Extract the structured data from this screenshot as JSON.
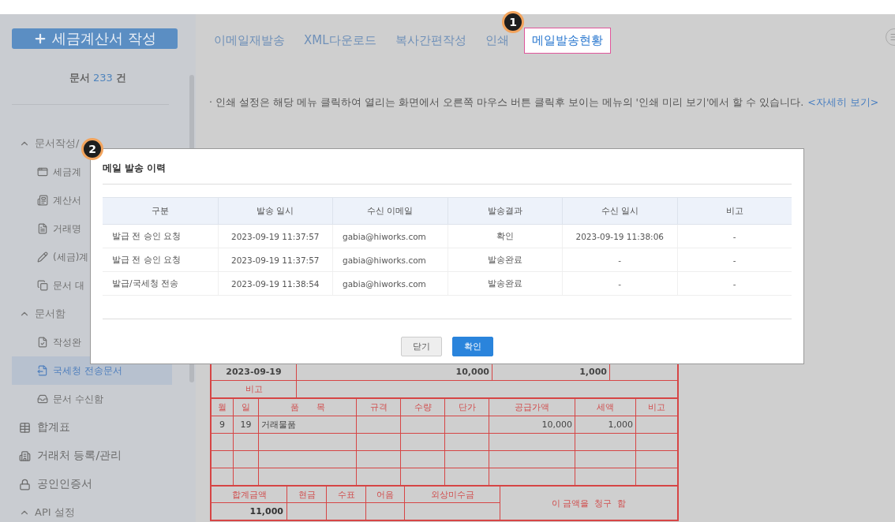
{
  "sidebar": {
    "create_button": {
      "label": "세금계산서 작성"
    },
    "doc_count": {
      "label": "문서",
      "count": "233",
      "unit": "건"
    },
    "items": [
      {
        "kind": "section",
        "label": "문서작성/",
        "expanded": true,
        "children": [
          {
            "label": "세금계",
            "selected": false
          },
          {
            "label": "계산서",
            "selected": false
          },
          {
            "label": "거래명",
            "selected": false
          },
          {
            "label": "(세금)계",
            "selected": false
          },
          {
            "label": "문서 대",
            "selected": false
          }
        ]
      },
      {
        "kind": "section",
        "label": "문서함",
        "expanded": true,
        "children": [
          {
            "label": "작성완",
            "selected": false
          },
          {
            "label": "국세청 전송문서",
            "selected": true
          },
          {
            "label": "문서 수신함",
            "selected": false
          }
        ]
      },
      {
        "kind": "link",
        "label": "합계표"
      },
      {
        "kind": "link",
        "label": "거래처 등록/관리"
      },
      {
        "kind": "link",
        "label": "공인인증서"
      },
      {
        "kind": "section",
        "label": "API 설정",
        "expanded": true
      }
    ]
  },
  "tabs": [
    {
      "label": "이메일재발송",
      "selected": false
    },
    {
      "label": "XML다운로드",
      "selected": false
    },
    {
      "label": "복사간편작성",
      "selected": false
    },
    {
      "label": "인쇄",
      "selected": false
    },
    {
      "label": "메일발송현황",
      "selected": true
    }
  ],
  "notice": {
    "text": "· 인쇄 설정은 해당 메뉴 클릭하여 열리는 화면에서 오른쪽 마우스 버튼 클릭후 보이는 메뉴의 '인쇄 미리 보기'에서 할 수 있습니다.",
    "link": "<자세히 보기>"
  },
  "annotations": [
    "1",
    "2"
  ],
  "invoice": {
    "top_row": [
      "2023-09-19",
      "10,000",
      "1,000"
    ],
    "remark_label": "비고",
    "item_columns": [
      "월",
      "일",
      "품　　목",
      "규격",
      "수량",
      "단가",
      "공급가액",
      "세액",
      "비고"
    ],
    "item_rows": [
      {
        "month": "9",
        "day": "19",
        "item": "거래물품",
        "supply": "10,000",
        "tax": "1,000"
      }
    ],
    "total_labels": [
      "합계금액",
      "현금",
      "수표",
      "어음",
      "외상미수금"
    ],
    "total_value": "11,000",
    "claim": "이 금액을  청구  함"
  },
  "modal": {
    "title": "메일 발송 이력",
    "columns": [
      "구분",
      "발송 일시",
      "수신 이메일",
      "발송결과",
      "수신 일시",
      "비고"
    ],
    "rows": [
      [
        "발급 전 승인 요청",
        "2023-09-19 11:37:57",
        "gabia@hiworks.com",
        "확인",
        "2023-09-19 11:38:06",
        "-"
      ],
      [
        "발급 전 승인 요청",
        "2023-09-19 11:37:57",
        "gabia@hiworks.com",
        "발송완료",
        "-",
        "-"
      ],
      [
        "발급/국세청 전송",
        "2023-09-19 11:38:54",
        "gabia@hiworks.com",
        "발송완료",
        "-",
        "-"
      ]
    ],
    "buttons": [
      {
        "label": "닫기",
        "kind": "secondary"
      },
      {
        "label": "확인",
        "kind": "primary"
      }
    ]
  }
}
